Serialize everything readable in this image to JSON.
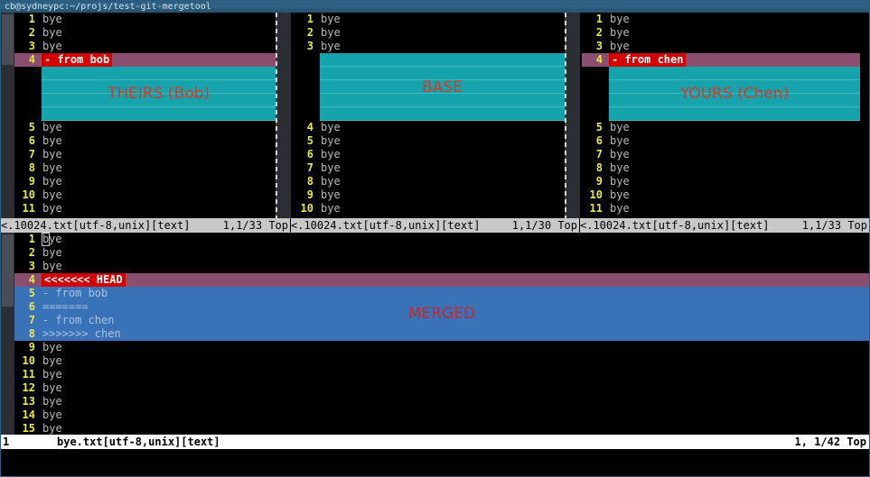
{
  "window": {
    "title": "cb@sydneypc:~/projs/test-git-mergetool"
  },
  "panes": {
    "theirs": {
      "label": "THEIRS (Bob)",
      "pre_lines": [
        {
          "num": "1",
          "text": "bye"
        },
        {
          "num": "2",
          "text": "bye"
        },
        {
          "num": "3",
          "text": "bye"
        }
      ],
      "conflict_line": {
        "num": "4",
        "badge": "- from bob"
      },
      "post_lines": [
        {
          "num": "5",
          "text": "bye"
        },
        {
          "num": "6",
          "text": "bye"
        },
        {
          "num": "7",
          "text": "bye"
        },
        {
          "num": "8",
          "text": "bye"
        },
        {
          "num": "9",
          "text": "bye"
        },
        {
          "num": "10",
          "text": "bye"
        },
        {
          "num": "11",
          "text": "bye"
        }
      ],
      "status": {
        "file": "<.10024.txt[utf-8,unix][text]",
        "position": "1,1/33  Top"
      }
    },
    "base": {
      "label": "BASE",
      "pre_lines": [
        {
          "num": "1",
          "text": "bye"
        },
        {
          "num": "2",
          "text": "bye"
        },
        {
          "num": "3",
          "text": "bye"
        }
      ],
      "post_lines": [
        {
          "num": "4",
          "text": "bye"
        },
        {
          "num": "5",
          "text": "bye"
        },
        {
          "num": "6",
          "text": "bye"
        },
        {
          "num": "7",
          "text": "bye"
        },
        {
          "num": "8",
          "text": "bye"
        },
        {
          "num": "9",
          "text": "bye"
        },
        {
          "num": "10",
          "text": "bye"
        }
      ],
      "status": {
        "file": "<.10024.txt[utf-8,unix][text]",
        "position": "1,1/30  Top"
      }
    },
    "yours": {
      "label": "YOURS (Chen)",
      "pre_lines": [
        {
          "num": "1",
          "text": "bye"
        },
        {
          "num": "2",
          "text": "bye"
        },
        {
          "num": "3",
          "text": "bye"
        }
      ],
      "conflict_line": {
        "num": "4",
        "badge": "- from chen"
      },
      "post_lines": [
        {
          "num": "5",
          "text": "bye"
        },
        {
          "num": "6",
          "text": "bye"
        },
        {
          "num": "7",
          "text": "bye"
        },
        {
          "num": "8",
          "text": "bye"
        },
        {
          "num": "9",
          "text": "bye"
        },
        {
          "num": "10",
          "text": "bye"
        },
        {
          "num": "11",
          "text": "bye"
        }
      ],
      "status": {
        "file": "<.10024.txt[utf-8,unix][text]",
        "position": "1,1/33  Top"
      }
    },
    "merged": {
      "label": "MERGED",
      "pre_lines": [
        {
          "num": "1",
          "text": "bye",
          "cursor": "b",
          "rest": "ye"
        },
        {
          "num": "2",
          "text": "bye"
        },
        {
          "num": "3",
          "text": "bye"
        }
      ],
      "conflict_start": {
        "num": "4",
        "badge": "<<<<<<< HEAD"
      },
      "conflict_body": [
        {
          "num": "5",
          "text": "- from bob"
        },
        {
          "num": "6",
          "text": "======="
        },
        {
          "num": "7",
          "text": "- from chen"
        },
        {
          "num": "8",
          "text": ">>>>>>> chen"
        }
      ],
      "post_lines": [
        {
          "num": "9",
          "text": "bye"
        },
        {
          "num": "10",
          "text": "bye"
        },
        {
          "num": "11",
          "text": "bye"
        },
        {
          "num": "12",
          "text": "bye"
        },
        {
          "num": "13",
          "text": "bye"
        },
        {
          "num": "14",
          "text": "bye"
        },
        {
          "num": "15",
          "text": "bye"
        }
      ]
    }
  },
  "bottom_status": {
    "line_number": "1",
    "file": "bye.txt[utf-8,unix][text]",
    "position": "1, 1/42 Top"
  },
  "colors": {
    "titlebar": "#2f6285",
    "conflict_header": "#8a4f6e",
    "marker_badge": "#d40000",
    "fill_block": "#16a3ab",
    "merge_block": "#3a72b8",
    "annotation": "#d23b2c",
    "line_number": "#e8e84a",
    "status_bar": "#c8c8c8"
  }
}
